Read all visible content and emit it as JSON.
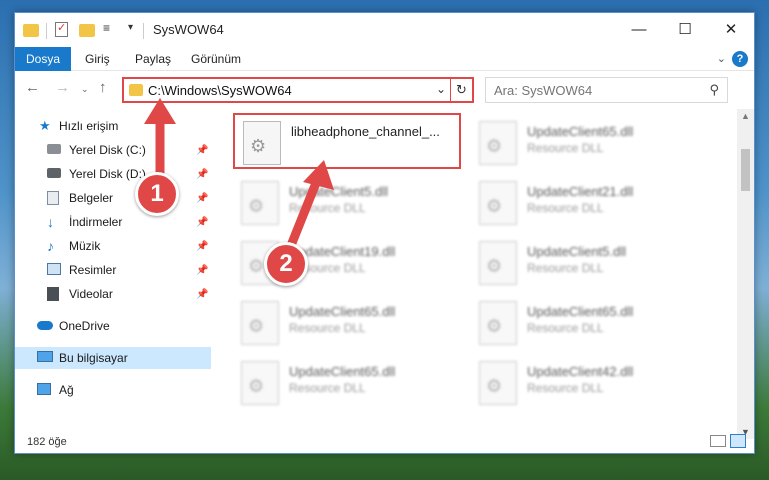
{
  "window": {
    "title": "SysWOW64",
    "controls": {
      "minimize": "—",
      "maximize": "☐",
      "close": "✕"
    }
  },
  "quick_access_toolbar": {
    "customize_glyph": "≡",
    "dropdown_glyph": "▾"
  },
  "ribbon": {
    "tabs": [
      {
        "label": "Dosya",
        "active": true
      },
      {
        "label": "Giriş"
      },
      {
        "label": "Paylaş"
      },
      {
        "label": "Görünüm"
      }
    ],
    "expand_glyph": "⌄",
    "help_glyph": "?"
  },
  "navigation": {
    "back_glyph": "←",
    "forward_glyph": "→",
    "recent_glyph": "⌄",
    "up_glyph": "↑",
    "address": "C:\\Windows\\SysWOW64",
    "address_dropdown_glyph": "⌄",
    "refresh_glyph": "↻",
    "search_placeholder": "Ara: SysWOW64"
  },
  "nav_pane": {
    "items": [
      {
        "label": "Hızlı erişim",
        "icon": "star-icon"
      },
      {
        "label": "Yerel Disk (C:)",
        "icon": "drive-icon",
        "pinned": true
      },
      {
        "label": "Yerel Disk (D:)",
        "icon": "drive-icon",
        "pinned": true
      },
      {
        "label": "Belgeler",
        "icon": "documents-icon",
        "pinned": true
      },
      {
        "label": "İndirmeler",
        "icon": "download-icon",
        "pinned": true
      },
      {
        "label": "Müzik",
        "icon": "music-icon",
        "pinned": true
      },
      {
        "label": "Resimler",
        "icon": "pictures-icon",
        "pinned": true
      },
      {
        "label": "Videolar",
        "icon": "videos-icon",
        "pinned": true
      },
      {
        "label": "OneDrive",
        "icon": "cloud-icon"
      },
      {
        "label": "Bu bilgisayar",
        "icon": "computer-icon",
        "selected": true
      },
      {
        "label": "Ağ",
        "icon": "network-icon"
      }
    ],
    "pin_glyph": "📌"
  },
  "files": [
    {
      "name": "libheadphone_channel_...",
      "type": "",
      "highlighted": true
    },
    {
      "name": "UpdateClient65.dll",
      "type": "Resource DLL"
    },
    {
      "name": "UpdateClient5.dll",
      "type": "Resource DLL"
    },
    {
      "name": "UpdateClient21.dll",
      "type": "Resource DLL"
    },
    {
      "name": "UpdateClient19.dll",
      "type": "Resource DLL"
    },
    {
      "name": "UpdateClient5.dll",
      "type": "Resource DLL"
    },
    {
      "name": "UpdateClient65.dll",
      "type": "Resource DLL"
    },
    {
      "name": "UpdateClient65.dll",
      "type": "Resource DLL"
    },
    {
      "name": "UpdateClient65.dll",
      "type": "Resource DLL"
    },
    {
      "name": "UpdateClient42.dll",
      "type": "Resource DLL"
    }
  ],
  "status_bar": {
    "item_count": "182 öğe"
  },
  "callouts": [
    {
      "number": "1",
      "color": "#e04848"
    },
    {
      "number": "2",
      "color": "#e04848"
    }
  ],
  "colors": {
    "accent": "#1979ca",
    "highlight": "#e04848",
    "selected": "#cce8ff"
  }
}
